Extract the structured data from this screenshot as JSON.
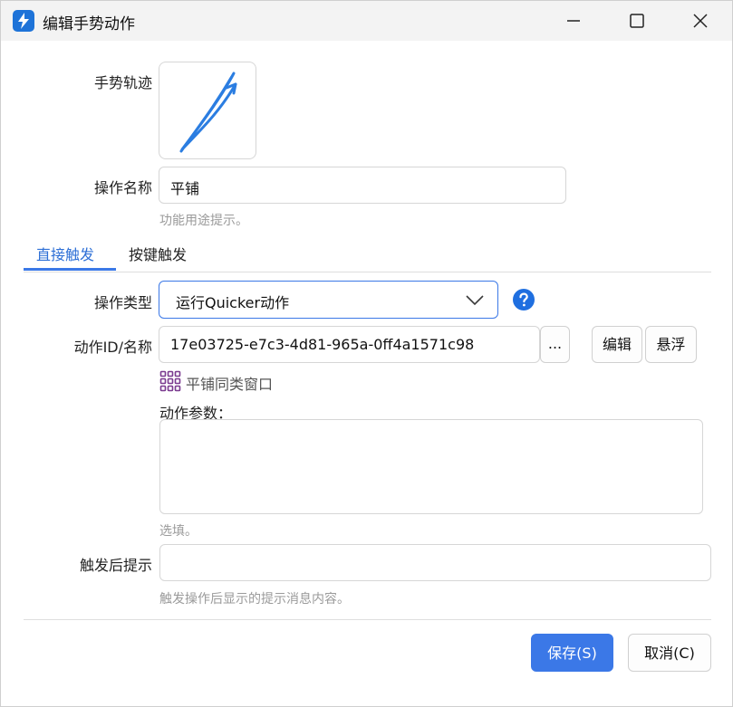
{
  "window": {
    "title": "编辑手势动作",
    "icons": {
      "app": "quicker-bolt-icon",
      "minimize": "minimize-icon",
      "maximize": "maximize-icon",
      "close": "close-icon"
    }
  },
  "gesture": {
    "label": "手势轨迹",
    "color": "#2b7de1"
  },
  "name_field": {
    "label": "操作名称",
    "value": "平铺",
    "hint": "功能用途提示。"
  },
  "tabs": [
    {
      "label": "直接触发",
      "active": true
    },
    {
      "label": "按键触发",
      "active": false
    }
  ],
  "action_type": {
    "label": "操作类型",
    "value": "运行Quicker动作",
    "help_icon": "question-icon"
  },
  "action_id": {
    "label": "动作ID/名称",
    "value": "17e03725-e7c3-4d81-965a-0ff4a1571c98",
    "browse_label": "...",
    "edit_label": "编辑",
    "float_label": "悬浮",
    "resolved_name": "平铺同类窗口",
    "resolved_icon": "grid-icon"
  },
  "params": {
    "label": "动作参数：",
    "value": "",
    "hint": "选填。"
  },
  "after_hint": {
    "label": "触发后提示",
    "value": "",
    "hint": "触发操作后显示的提示消息内容。"
  },
  "footer": {
    "save_label": "保存(S)",
    "cancel_label": "取消(C)"
  },
  "colors": {
    "accent": "#3b78e7",
    "help": "#1f6fe0",
    "grid_icon": "#7a3a8f"
  }
}
